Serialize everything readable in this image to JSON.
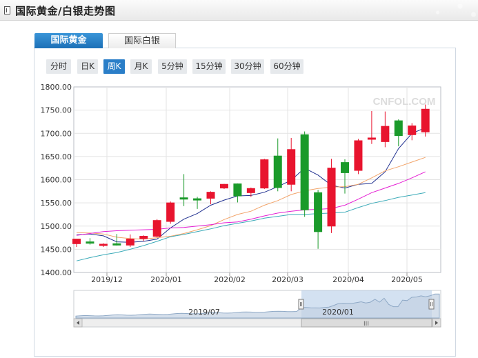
{
  "page": {
    "title": "国际黄金/白银走势图",
    "tabs": [
      {
        "label": "国际黄金",
        "active": true
      },
      {
        "label": "国际白银",
        "active": false
      }
    ],
    "periods": [
      {
        "label": "分时",
        "active": false
      },
      {
        "label": "日K",
        "active": false
      },
      {
        "label": "周K",
        "active": true
      },
      {
        "label": "月K",
        "active": false
      },
      {
        "label": "5分钟",
        "active": false
      },
      {
        "label": "15分钟",
        "active": false
      },
      {
        "label": "30分钟",
        "active": false
      },
      {
        "label": "60分钟",
        "active": false
      }
    ],
    "watermark": "CNFOL.COM",
    "navigator": {
      "labels": [
        "2019/07",
        "2020/01"
      ],
      "grip": "III"
    },
    "colors": {
      "up": "#e8142e",
      "down": "#1a9a2a",
      "ma5": "#1f2f8f",
      "ma10": "#f2a46a",
      "ma20": "#e51ed3",
      "ma30": "#3aaab8",
      "accent": "#2a7ec8"
    }
  },
  "chart_data": {
    "type": "candlestick",
    "xlabels": [
      "2019/12",
      "2020/01",
      "2020/02",
      "2020/03",
      "2020/04",
      "2020/05"
    ],
    "ylim": [
      1400,
      1800
    ],
    "yticks": [
      "1800.00",
      "1750.00",
      "1700.00",
      "1650.00",
      "1600.00",
      "1550.00",
      "1500.00",
      "1450.00",
      "1400.00"
    ],
    "grid": true,
    "candles": [
      {
        "o": 1462,
        "h": 1469,
        "l": 1455,
        "c": 1472
      },
      {
        "o": 1466,
        "h": 1474,
        "l": 1460,
        "c": 1463
      },
      {
        "o": 1459,
        "h": 1463,
        "l": 1455,
        "c": 1461
      },
      {
        "o": 1462,
        "h": 1483,
        "l": 1458,
        "c": 1460
      },
      {
        "o": 1459,
        "h": 1482,
        "l": 1455,
        "c": 1472
      },
      {
        "o": 1473,
        "h": 1480,
        "l": 1468,
        "c": 1478
      },
      {
        "o": 1478,
        "h": 1515,
        "l": 1476,
        "c": 1512
      },
      {
        "o": 1510,
        "h": 1553,
        "l": 1505,
        "c": 1550
      },
      {
        "o": 1561,
        "h": 1612,
        "l": 1543,
        "c": 1559
      },
      {
        "o": 1559,
        "h": 1563,
        "l": 1537,
        "c": 1556
      },
      {
        "o": 1560,
        "h": 1575,
        "l": 1547,
        "c": 1573
      },
      {
        "o": 1582,
        "h": 1591,
        "l": 1580,
        "c": 1590
      },
      {
        "o": 1591,
        "h": 1592,
        "l": 1551,
        "c": 1565
      },
      {
        "o": 1572,
        "h": 1583,
        "l": 1563,
        "c": 1581
      },
      {
        "o": 1582,
        "h": 1645,
        "l": 1580,
        "c": 1643
      },
      {
        "o": 1651,
        "h": 1689,
        "l": 1575,
        "c": 1583
      },
      {
        "o": 1590,
        "h": 1690,
        "l": 1575,
        "c": 1665
      },
      {
        "o": 1697,
        "h": 1704,
        "l": 1520,
        "c": 1535
      },
      {
        "o": 1572,
        "h": 1578,
        "l": 1451,
        "c": 1488
      },
      {
        "o": 1500,
        "h": 1645,
        "l": 1485,
        "c": 1625
      },
      {
        "o": 1637,
        "h": 1644,
        "l": 1570,
        "c": 1615
      },
      {
        "o": 1620,
        "h": 1688,
        "l": 1612,
        "c": 1684
      },
      {
        "o": 1688,
        "h": 1748,
        "l": 1677,
        "c": 1690
      },
      {
        "o": 1682,
        "h": 1747,
        "l": 1670,
        "c": 1715
      },
      {
        "o": 1727,
        "h": 1730,
        "l": 1672,
        "c": 1695
      },
      {
        "o": 1697,
        "h": 1722,
        "l": 1685,
        "c": 1716
      },
      {
        "o": 1703,
        "h": 1762,
        "l": 1693,
        "c": 1752
      }
    ],
    "moving_averages": [
      {
        "key": "ma5",
        "values": [
          1481,
          1483,
          1479,
          1466,
          1465,
          1467,
          1472,
          1496,
          1515,
          1527,
          1545,
          1556,
          1565,
          1566,
          1573,
          1585,
          1599,
          1625,
          1610,
          1588,
          1582,
          1590,
          1592,
          1617,
          1667,
          1700,
          1712
        ]
      },
      {
        "key": "ma10",
        "values": [
          1486,
          1485,
          1483,
          1476,
          1473,
          1472,
          1475,
          1478,
          1484,
          1492,
          1501,
          1514,
          1525,
          1532,
          1545,
          1555,
          1568,
          1576,
          1581,
          1584,
          1585,
          1590,
          1604,
          1619,
          1628,
          1638,
          1648
        ]
      },
      {
        "key": "ma20",
        "values": [
          1480,
          1484,
          1488,
          1490,
          1491,
          1492,
          1493,
          1496,
          1497,
          1500,
          1503,
          1507,
          1509,
          1515,
          1522,
          1528,
          1532,
          1535,
          1536,
          1538,
          1545,
          1558,
          1572,
          1582,
          1592,
          1604,
          1617
        ]
      },
      {
        "key": "ma30",
        "values": [
          1425,
          1432,
          1438,
          1443,
          1450,
          1458,
          1467,
          1477,
          1482,
          1488,
          1494,
          1501,
          1506,
          1511,
          1517,
          1521,
          1525,
          1525,
          1527,
          1528,
          1530,
          1540,
          1549,
          1555,
          1562,
          1567,
          1572
        ]
      }
    ]
  }
}
